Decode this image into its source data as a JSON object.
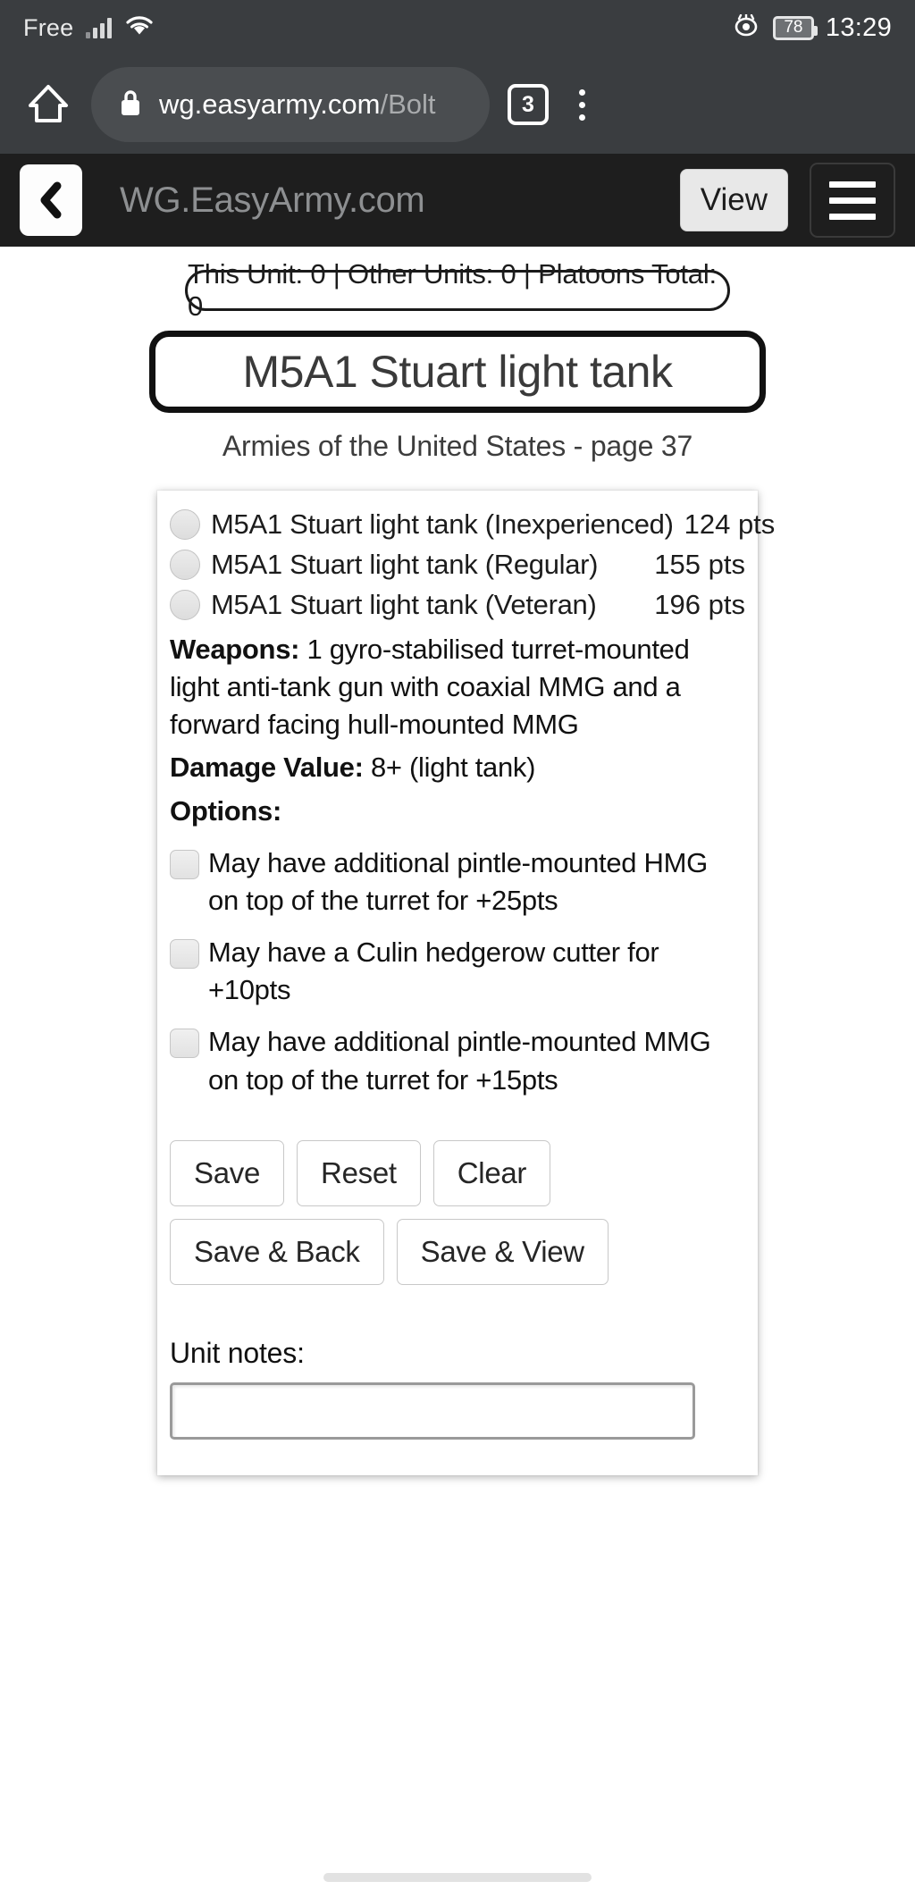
{
  "status_bar": {
    "carrier": "Free",
    "battery_level": "78",
    "time": "13:29",
    "signal_icon": "signal-bars-icon",
    "wifi_icon": "wifi-icon",
    "eye_icon": "eye-icon"
  },
  "browser": {
    "home_icon": "home-icon",
    "lock_icon": "lock-icon",
    "url_domain": "wg.easyarmy.com",
    "url_path": "/Bolt",
    "tab_count": "3",
    "menu_icon": "kebab-menu-icon"
  },
  "app_header": {
    "back_icon": "chevron-left-icon",
    "title": "WG.EasyArmy.com",
    "view_label": "View",
    "menu_icon": "hamburger-menu-icon"
  },
  "points_bar": {
    "text": "This Unit: 0 | Other Units: 0 | Platoons Total: 0"
  },
  "unit": {
    "name": "M5A1 Stuart light tank",
    "source": "Armies of the United States - page 37"
  },
  "quality_options": [
    {
      "label": "M5A1 Stuart light tank (Inexperienced)",
      "points": "124 pts"
    },
    {
      "label": "M5A1 Stuart light tank (Regular)",
      "points": "155 pts"
    },
    {
      "label": "M5A1 Stuart light tank (Veteran)",
      "points": "196 pts"
    }
  ],
  "stats": {
    "weapons_label": "Weapons:",
    "weapons_text": " 1 gyro-stabilised turret-mounted light anti-tank gun with coaxial MMG and a forward facing hull-mounted MMG",
    "damage_label": "Damage Value:",
    "damage_text": " 8+ (light tank)",
    "options_label": "Options:"
  },
  "upgrade_options": [
    "May have additional pintle-mounted HMG on top of the turret for +25pts",
    "May have a Culin hedgerow cutter for +10pts",
    "May have additional pintle-mounted MMG on top of the turret for +15pts"
  ],
  "buttons": [
    "Save",
    "Reset",
    "Clear",
    "Save & Back",
    "Save & View"
  ],
  "notes": {
    "label": "Unit notes:",
    "value": "",
    "placeholder": ""
  }
}
